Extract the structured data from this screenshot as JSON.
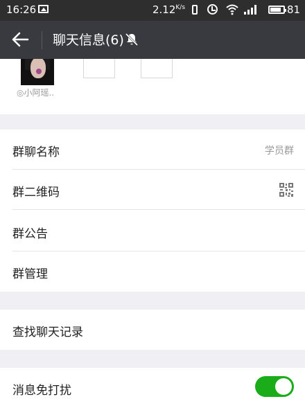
{
  "status_bar": {
    "time": "16:26",
    "speed": "2.12",
    "speed_unit": "K/s",
    "battery_level": "81",
    "battery_fraction": 0.81
  },
  "action_bar": {
    "title": "聊天信息(6)",
    "back_icon": "back-arrow-icon",
    "mute_icon": "bell-off-icon"
  },
  "members": {
    "first_member_name": "◎小阿瑶..",
    "add_icon": "plus-icon",
    "remove_icon": "minus-icon"
  },
  "settings": {
    "group_name_label": "群聊名称",
    "group_name_value": "学员群",
    "qr_label": "群二维码",
    "announcement_label": "群公告",
    "manage_label": "群管理",
    "search_history_label": "查找聊天记录",
    "mute_label": "消息免打扰",
    "mute_enabled": true
  },
  "colors": {
    "toggle_on": "#1aad19",
    "action_bar": "#393a3f",
    "status_bar": "#2e2e2e"
  }
}
